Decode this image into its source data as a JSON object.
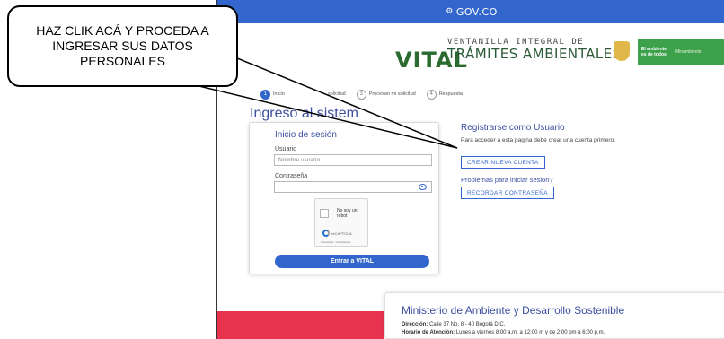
{
  "gov_bar": {
    "icon": "gov-logo-icon",
    "label": "GOV.CO"
  },
  "header": {
    "subtitle_top": "VENTANILLA INTEGRAL DE",
    "subtitle_bottom": "TRÁMITES AMBIENTALES",
    "logo": "VITAL",
    "ambiente_seal": "El ambiente es de todos",
    "ministry_short": "Minambiente"
  },
  "steps": [
    {
      "number": "1",
      "label": "Inicio"
    },
    {
      "number": "",
      "label": "solicitud"
    },
    {
      "number": "3",
      "label": "Procesan mi solicitud"
    },
    {
      "number": "4",
      "label": "Respuesta"
    }
  ],
  "page_title": "Ingreso al sistem",
  "login": {
    "title": "Inicio de sesión",
    "user_label": "Usuario",
    "user_placeholder": "Nombre usuario",
    "password_label": "Contraseña",
    "captcha_label": "No soy un robot",
    "captcha_brand": "reCAPTCHA",
    "captcha_links": "Privacidad - Condiciones",
    "submit": "Entrar a VITAL"
  },
  "register": {
    "title": "Registrarse como Usuario",
    "description": "Para acceder a esta pagina debe crear una cuenta primero.",
    "create_button": "CREAR NUEVA CUENTA",
    "problems_title": "Problemas para iniciar sesion?",
    "recover_button": "RECORDAR CONTRASEÑA"
  },
  "ministry": {
    "title": "Ministerio de Ambiente y Desarrollo Sostenible",
    "address_label": "Dirección:",
    "address": "Calle 37 No. 8 - 40 Bogotá D.C.",
    "hours_label": "Horario de Atención:",
    "hours": "Lunes a viernes 8:00 a.m. a 12:00 m y de 2:00 pm a 6:00 p.m."
  },
  "callout": {
    "text": "HAZ CLIK ACÁ Y PROCEDA A INGRESAR SUS DATOS PERSONALES"
  },
  "colors": {
    "gov_blue": "#3366cc",
    "brand_green": "#2b6b2f",
    "accent_red": "#e8334f"
  }
}
